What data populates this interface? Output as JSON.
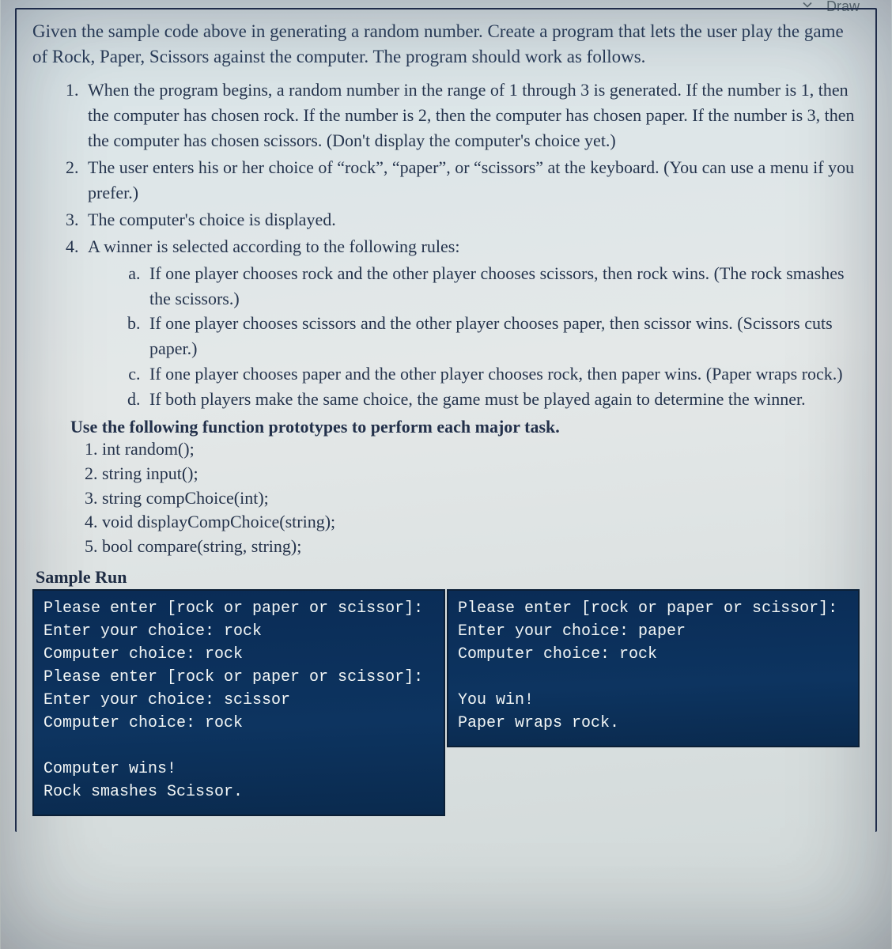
{
  "toolbar": {
    "draw_label": "Draw"
  },
  "intro": "Given the sample code above in generating a random number. Create a program that lets the user play the game of Rock, Paper, Scissors against the computer. The program should work as follows.",
  "steps": {
    "s1": "When the program begins, a random number in the range of 1 through 3 is generated. If the number is 1, then the computer has chosen rock. If the number is 2, then the computer has chosen paper. If the number is 3, then the computer has chosen scissors. (Don't display the computer's choice yet.)",
    "s2": "The user enters his or her choice of “rock”, “paper”, or “scissors” at the keyboard. (You can use a menu if you prefer.)",
    "s3": "The computer's choice is displayed.",
    "s4": "A winner is selected according to the following rules:",
    "rules": {
      "a": "If one player chooses rock and the other player chooses scissors, then rock wins. (The rock smashes the scissors.)",
      "b": "If one player chooses scissors and the other player chooses paper, then scissor wins. (Scissors cuts paper.)",
      "c": "If one player chooses paper and the other player chooses rock, then paper wins. (Paper wraps rock.)",
      "d": "If both players make the same choice, the game must be played again to determine the winner."
    }
  },
  "proto_head": "Use the following function prototypes to perform each major task.",
  "protos": {
    "p1": "int random();",
    "p2": "string input();",
    "p3": "string compChoice(int);",
    "p4": "void displayCompChoice(string);",
    "p5": "bool compare(string, string);"
  },
  "sample_head": "Sample Run",
  "run_left": "Please enter [rock or paper or scissor]:\nEnter your choice: rock\nComputer choice: rock\nPlease enter [rock or paper or scissor]:\nEnter your choice: scissor\nComputer choice: rock\n\nComputer wins!\nRock smashes Scissor.",
  "run_right": "Please enter [rock or paper or scissor]:\nEnter your choice: paper\nComputer choice: rock\n\nYou win!\nPaper wraps rock."
}
